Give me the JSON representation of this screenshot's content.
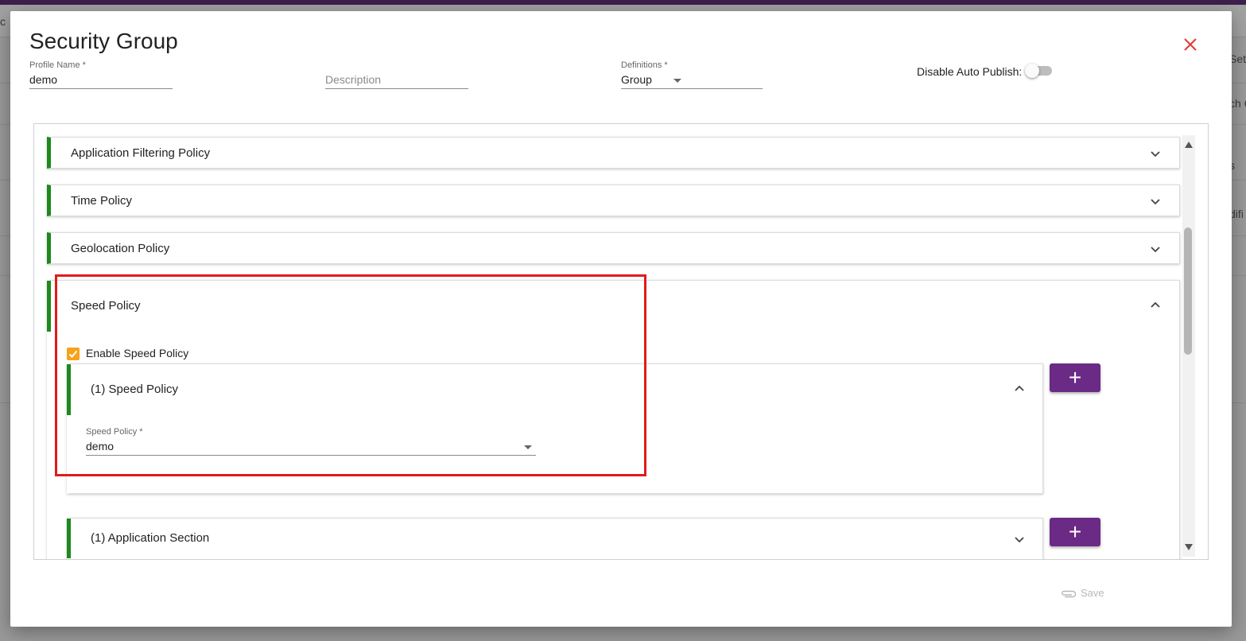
{
  "background": {
    "left_fragment": "c",
    "right_fragments": [
      "Sett",
      "ch C",
      "s",
      "difi"
    ]
  },
  "modal": {
    "title": "Security Group",
    "close_icon": "close-icon",
    "profile_name": {
      "label": "Profile Name *",
      "value": "demo"
    },
    "description": {
      "placeholder": "Description",
      "value": ""
    },
    "definitions": {
      "label": "Definitions *",
      "value": "Group"
    },
    "auto_publish": {
      "label": "Disable Auto Publish:",
      "enabled": false
    },
    "policies": [
      {
        "title": "Application Filtering Policy",
        "expanded": false
      },
      {
        "title": "Time Policy",
        "expanded": false
      },
      {
        "title": "Geolocation Policy",
        "expanded": false
      },
      {
        "title": "Speed Policy",
        "expanded": true,
        "enable_label": "Enable Speed Policy",
        "enabled": true,
        "sub_panels": [
          {
            "title": "(1) Speed Policy",
            "expanded": true,
            "field": {
              "label": "Speed Policy *",
              "value": "demo"
            },
            "add_label": "+"
          },
          {
            "title": "(1) Application Section",
            "expanded": false,
            "add_label": "+"
          }
        ]
      }
    ],
    "save_label": "Save"
  },
  "colors": {
    "accent_green": "#1c8a1c",
    "add_button_purple": "#6b2a86",
    "checkbox_orange": "#f5a31a",
    "close_red": "#e53935",
    "highlight_red": "#e01b1b"
  }
}
